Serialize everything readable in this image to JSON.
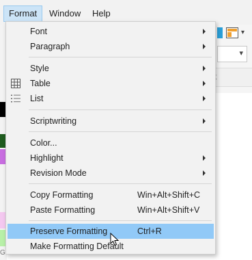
{
  "menubar": {
    "items": [
      {
        "label": "Format",
        "active": true
      },
      {
        "label": "Window",
        "active": false
      },
      {
        "label": "Help",
        "active": false
      }
    ]
  },
  "background": {
    "ruler_text": "t",
    "status_text": "GE",
    "swatch_colors": [
      "#000000",
      "#1f5c1f",
      "#c86ee0",
      "#f4c8f0",
      "#b8f0a8"
    ]
  },
  "format_menu": {
    "font": {
      "label": "Font"
    },
    "paragraph": {
      "label": "Paragraph"
    },
    "style": {
      "label": "Style"
    },
    "table": {
      "label": "Table",
      "icon": "table-grid-icon"
    },
    "list": {
      "label": "List",
      "icon": "bullet-list-icon"
    },
    "scriptwriting": {
      "label": "Scriptwriting"
    },
    "color": {
      "label": "Color..."
    },
    "highlight": {
      "label": "Highlight"
    },
    "revision_mode": {
      "label": "Revision Mode"
    },
    "copy_formatting": {
      "label": "Copy Formatting",
      "shortcut": "Win+Alt+Shift+C"
    },
    "paste_formatting": {
      "label": "Paste Formatting",
      "shortcut": "Win+Alt+Shift+V"
    },
    "preserve_formatting": {
      "label": "Preserve Formatting",
      "shortcut": "Ctrl+R",
      "highlighted": true
    },
    "make_formatting_default": {
      "label": "Make Formatting Default"
    }
  },
  "colors": {
    "highlight": "#91c9f7",
    "menu_background": "#f2f2f2",
    "active_menubar": "#cce4f7"
  }
}
